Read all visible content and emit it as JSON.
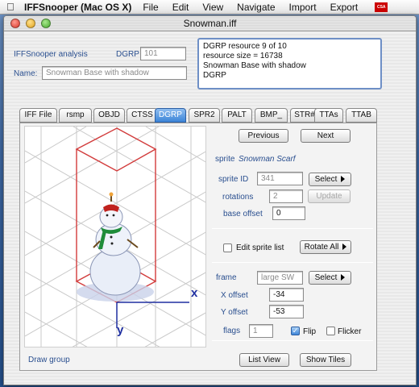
{
  "menubar": {
    "app_name": "IFFSnooper (Mac OS X)",
    "items": [
      "File",
      "Edit",
      "View",
      "Navigate",
      "Import",
      "Export"
    ],
    "flag_text": "CSA"
  },
  "window": {
    "title": "Snowman.iff"
  },
  "header": {
    "analysis_label": "IFFSnooper analysis",
    "dgrp_label": "DGRP #",
    "dgrp_value": "101",
    "name_label": "Name:",
    "name_value": "Snowman Base with shadow",
    "info_lines": [
      "DGRP resource 9 of 10",
      "resource size =   16738",
      "Snowman Base with shadow",
      "DGRP"
    ]
  },
  "tabs": [
    "IFF File",
    "rsmp",
    "OBJD",
    "CTSS",
    "DGRP",
    "SPR2",
    "PALT",
    "BMP_",
    "STR#",
    "TTAs",
    "TTAB"
  ],
  "active_tab": "DGRP",
  "nav": {
    "previous": "Previous",
    "next": "Next"
  },
  "sprite": {
    "label": "sprite",
    "name": "Snowman Scarf",
    "id_label": "sprite ID",
    "id_value": "341",
    "select_label": "Select",
    "rotations_label": "rotations",
    "rotations_value": "2",
    "update_label": "Update",
    "base_offset_label": "base offset",
    "base_offset_value": "0"
  },
  "edit_sprite_list": {
    "label": "Edit sprite list",
    "checked": false
  },
  "rotate_all": "Rotate All",
  "frame": {
    "label": "frame",
    "value": "large SW",
    "select_label": "Select",
    "x_offset_label": "X offset",
    "x_offset_value": "-34",
    "y_offset_label": "Y offset",
    "y_offset_value": "-53",
    "flags_label": "flags",
    "flags_value": "1",
    "flip_label": "Flip",
    "flip_checked": true,
    "flicker_label": "Flicker",
    "flicker_checked": false
  },
  "canvas": {
    "x_axis": "x",
    "y_axis": "y"
  },
  "footer": {
    "draw_group": "Draw group",
    "list_view": "List View",
    "show_tiles": "Show Tiles"
  },
  "colors": {
    "accent": "#3c85d8",
    "label_blue": "#2a4f8f",
    "axis_blue": "#1f2fa0",
    "tile_red": "#d23b3b"
  }
}
